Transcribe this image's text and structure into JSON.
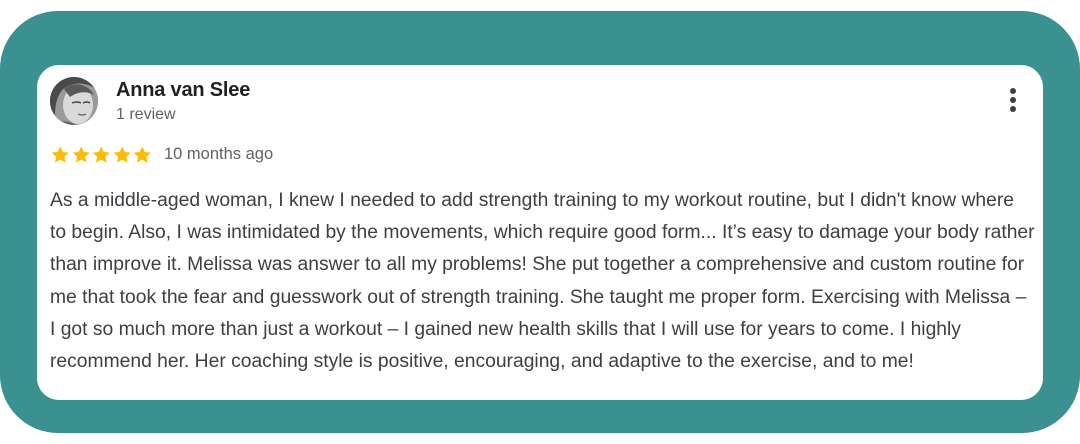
{
  "review": {
    "author_name": "Anna van Slee",
    "review_count": "1 review",
    "rating": 5,
    "timestamp": "10 months ago",
    "text": "As a middle-aged woman, I knew I needed to add strength training to my workout routine, but I didn't know where to begin. Also, I was intimidated by the movements, which require good form... It’s easy to damage your body rather than improve it. Melissa was answer to all my problems! She put together a comprehensive and custom routine for me that took the fear and guesswork out of strength training. She taught me proper form. Exercising with Melissa – I got so much more than just a workout – I gained new health skills that I will use for years to come. I highly recommend her. Her coaching style is positive, encouraging, and adaptive to the exercise, and to me!",
    "menu_icon": "more-vert-icon",
    "star_icon": "star-icon"
  },
  "colors": {
    "frame_background": "#3a918f",
    "card_background": "#ffffff",
    "star": "#fbbc04",
    "name": "#202124",
    "meta": "#5f6368",
    "body": "#3c4043"
  }
}
